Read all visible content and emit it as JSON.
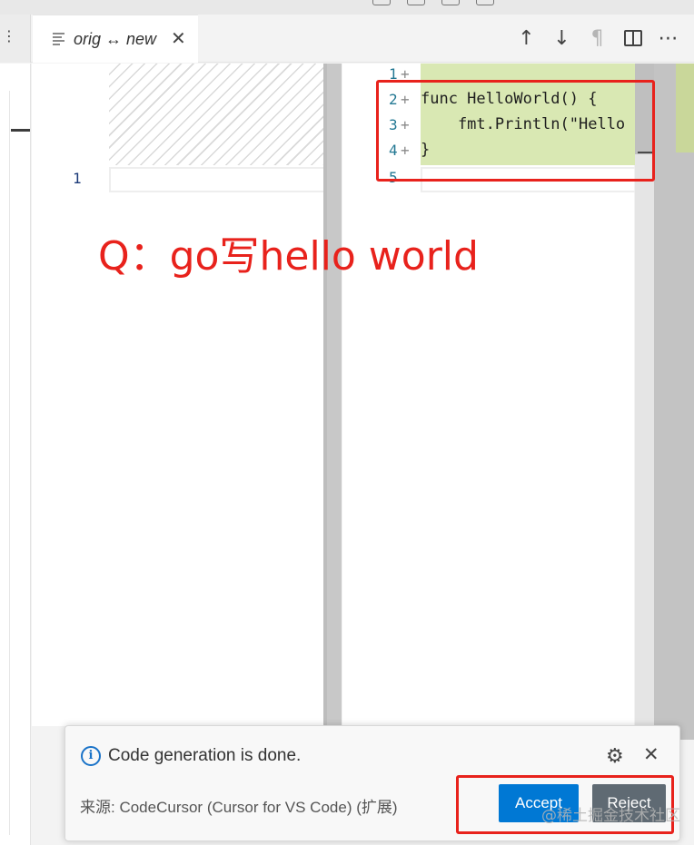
{
  "tab": {
    "title": "orig ↔ new",
    "close_glyph": "✕"
  },
  "left_tab_more": "⋮",
  "toolbar": {
    "up_glyph": "↑",
    "down_glyph": "↓",
    "pilcrow_glyph": "¶",
    "more_glyph": "⋯"
  },
  "left_editor": {
    "line_number": "1"
  },
  "right_editor": {
    "lines": [
      {
        "num": "1",
        "marker": "+",
        "code": ""
      },
      {
        "num": "2",
        "marker": "+",
        "code": "func HelloWorld() {"
      },
      {
        "num": "3",
        "marker": "+",
        "code": "    fmt.Println(\"Hello"
      },
      {
        "num": "4",
        "marker": "+",
        "code": "}"
      },
      {
        "num": "5",
        "marker": "",
        "code": ""
      }
    ]
  },
  "annotation": {
    "text": "Q：go写hello world"
  },
  "notification": {
    "message": "Code generation is done.",
    "source": "来源: CodeCursor (Cursor for VS Code) (扩展)",
    "accept_label": "Accept",
    "reject_label": "Reject",
    "close_glyph": "✕",
    "gear_glyph": "⚙",
    "info_glyph": "i"
  },
  "watermark": "@稀土掘金技术社区",
  "colors": {
    "accent": "#0078d4",
    "annotation_red": "#e8221c",
    "added_line_bg": "#d9e8b3"
  }
}
